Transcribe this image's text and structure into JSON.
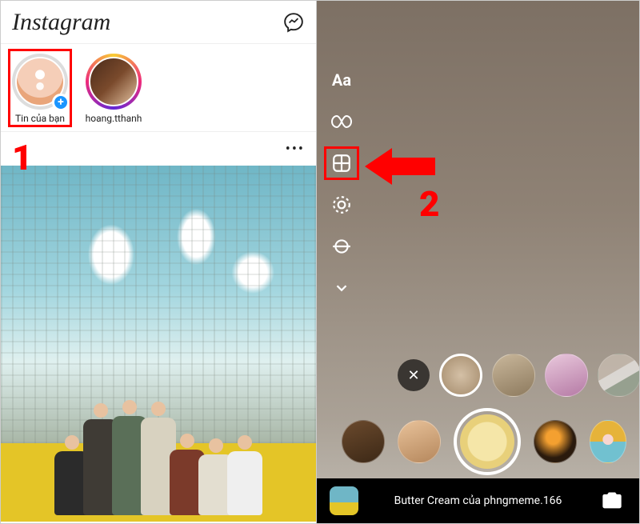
{
  "annotations": {
    "step1": "1",
    "step2": "2"
  },
  "left": {
    "app_name": "Instagram",
    "stories": {
      "own": {
        "label": "Tin của bạn"
      },
      "items": [
        {
          "label": "hoang.tthanh"
        }
      ]
    },
    "post_more": "•••"
  },
  "right": {
    "tools": {
      "text_label": "Aa"
    },
    "close_filter": "✕",
    "filter_caption": "Butter Cream của phngmeme.166"
  }
}
